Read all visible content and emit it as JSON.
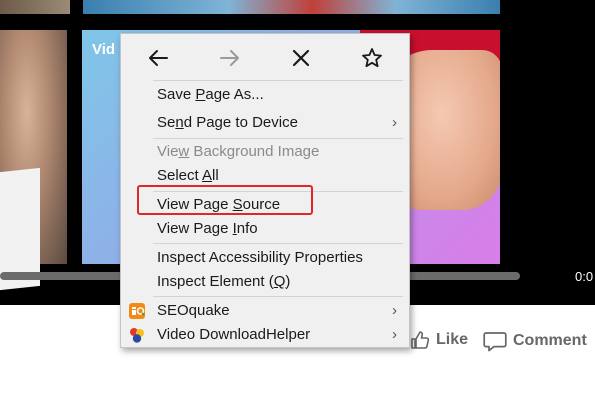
{
  "video": {
    "label": "Vid",
    "time": "0:0"
  },
  "actions": {
    "like_label": "Like",
    "comment_label": "Comment"
  },
  "context_menu": {
    "nav": [
      {
        "name": "back",
        "icon": "back-arrow-icon",
        "enabled": true
      },
      {
        "name": "forward",
        "icon": "forward-arrow-icon",
        "enabled": false
      },
      {
        "name": "reload",
        "icon": "close-icon",
        "enabled": true
      },
      {
        "name": "bookmark",
        "icon": "star-icon",
        "enabled": true
      }
    ],
    "items": {
      "save_page_as": {
        "pre": "Save ",
        "key": "P",
        "post": "age As..."
      },
      "send_page_to_device": {
        "pre": "Se",
        "key": "n",
        "post": "d Page to Device",
        "submenu": true
      },
      "view_background_image": {
        "pre": "Vie",
        "key": "w",
        "post": " Background Image",
        "disabled": true
      },
      "select_all": {
        "pre": "Select ",
        "key": "A",
        "post": "ll"
      },
      "view_page_source": {
        "pre": "View Page ",
        "key": "S",
        "post": "ource"
      },
      "view_page_info": {
        "pre": "View Page ",
        "key": "I",
        "post": "nfo"
      },
      "inspect_accessibility": {
        "pre": "Inspect Accessibility Properties",
        "key": "",
        "post": ""
      },
      "inspect_element": {
        "pre": "Inspect Element (",
        "key": "Q",
        "post": ")"
      },
      "seoquake": {
        "pre": "SEOquake",
        "key": "",
        "post": "",
        "submenu": true,
        "icon": "seoquake-icon"
      },
      "video_downloadhelper": {
        "pre": "Video DownloadHelper",
        "key": "",
        "post": "",
        "submenu": true,
        "icon": "downloadhelper-icon"
      }
    },
    "submenu_glyph": "›",
    "highlight_color": "#e0282a"
  }
}
